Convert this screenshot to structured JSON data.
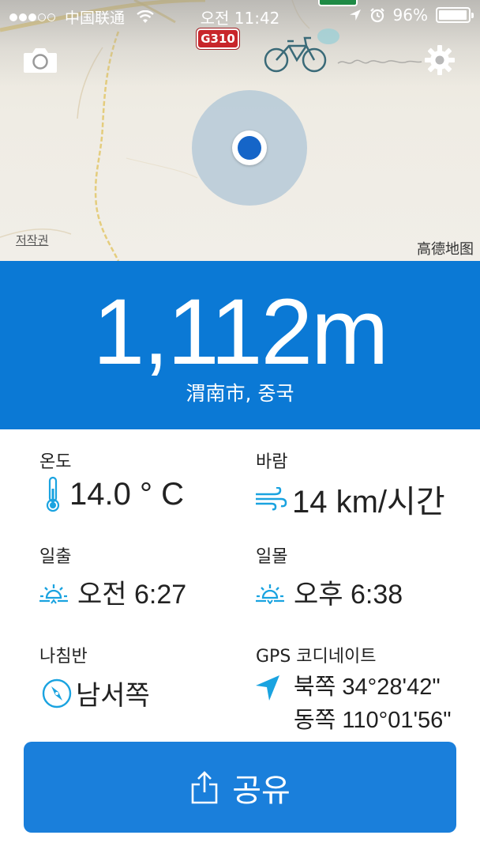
{
  "status_bar": {
    "carrier": "中国联通",
    "time": "오전 11:42",
    "battery": "96%",
    "battery_level": 0.96
  },
  "map": {
    "road_shield": "G310",
    "copyright": "저작권",
    "brand": "高德地图"
  },
  "altitude": {
    "value": "1,112m",
    "place": "渭南市, 중국"
  },
  "info": {
    "temperature": {
      "label": "온도",
      "value": "14.0 ° C",
      "icon": "thermometer-icon"
    },
    "wind": {
      "label": "바람",
      "value": "14 km/시간",
      "icon": "wind-icon"
    },
    "sunrise": {
      "label": "일출",
      "value": "오전 6:27",
      "icon": "sunrise-icon"
    },
    "sunset": {
      "label": "일몰",
      "value": "오후 6:38",
      "icon": "sunset-icon"
    },
    "compass": {
      "label": "나침반",
      "value": "남서쪽",
      "icon": "compass-icon"
    },
    "gps": {
      "label": "GPS 코디네이트",
      "latitude": "북쪽 34°28'42\"",
      "longitude": "동쪽 110°01'56\"",
      "icon": "location-arrow-icon"
    }
  },
  "share": {
    "label": "공유",
    "icon": "share-icon"
  },
  "colors": {
    "accent_blue": "#0b79d5",
    "button_blue": "#1a7fdb",
    "icon_cyan": "#1aa3e0",
    "location_blue": "#1565c8"
  }
}
